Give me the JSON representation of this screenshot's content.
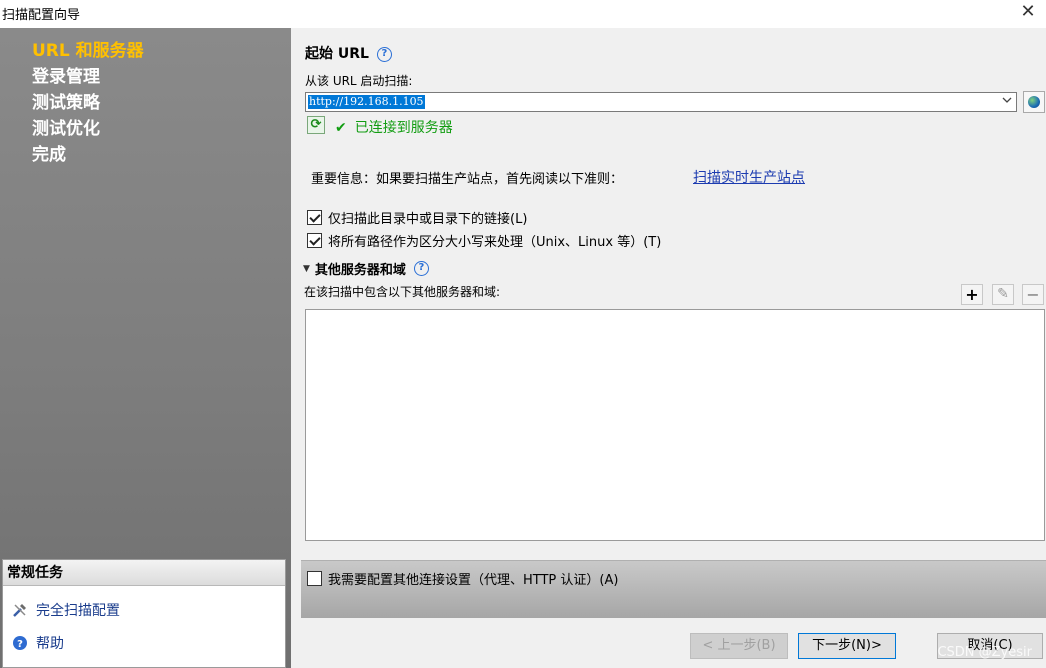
{
  "window": {
    "title": "扫描配置向导",
    "close_glyph": "✕"
  },
  "sidebar": {
    "steps": [
      {
        "label": "URL 和服务器",
        "active": true
      },
      {
        "label": "登录管理",
        "active": false
      },
      {
        "label": "测试策略",
        "active": false
      },
      {
        "label": "测试优化",
        "active": false
      },
      {
        "label": "完成",
        "active": false
      }
    ],
    "tasks_header": "常规任务",
    "tasks": [
      {
        "label": "完全扫描配置",
        "icon": "wrench-icon"
      },
      {
        "label": "帮助",
        "icon": "help-icon"
      }
    ]
  },
  "main": {
    "start_url_title": "起始 URL",
    "start_label": "从该 URL 启动扫描:",
    "url_value": "http://192.168.1.105",
    "status_text": "已连接到服务器",
    "info_text": "重要信息：如果要扫描生产站点，首先阅读以下准则：",
    "info_link": "扫描实时生产站点",
    "checkbox1": {
      "label": "仅扫描此目录中或目录下的链接(L)",
      "checked": true
    },
    "checkbox2": {
      "label": "将所有路径作为区分大小写来处理（Unix、Linux 等）(T)",
      "checked": true
    },
    "other_title": "其他服务器和域",
    "other_label": "在该扫描中包含以下其他服务器和域:",
    "add_glyph": "+",
    "edit_glyph": "✎",
    "remove_glyph": "−",
    "extra_settings": {
      "label": "我需要配置其他连接设置（代理、HTTP 认证）(A)",
      "checked": false
    }
  },
  "footer": {
    "back_label": "< 上一步(B)",
    "next_label": "下一步(N)>",
    "cancel_label": "取消(C)",
    "watermark": "CSDN @Zyesir"
  },
  "colors": {
    "active_step": "#ffc000",
    "status_green": "#129d12",
    "link_blue": "#1c3bb0"
  }
}
